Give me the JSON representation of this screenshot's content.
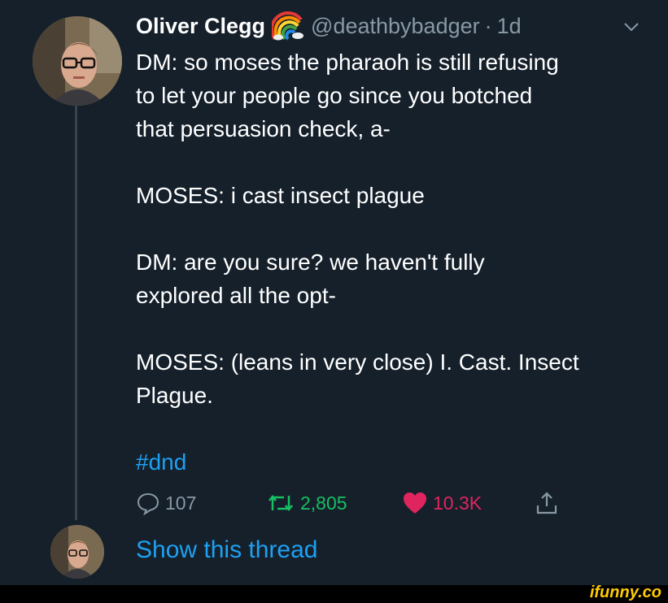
{
  "tweet": {
    "author_name": "Oliver Clegg",
    "handle": "@deathbybadger",
    "separator": "·",
    "time": "1d",
    "paragraphs": [
      "DM: so moses the pharaoh is still refusing\nto let your people go since you botched\nthat persuasion check, a-",
      "MOSES: i cast insect plague",
      "DM: are you sure? we haven't fully\nexplored all the opt-",
      "MOSES: (leans in very close) I. Cast. Insect\nPlague."
    ],
    "hashtag": "#dnd",
    "stats": {
      "replies": "107",
      "retweets": "2,805",
      "likes": "10.3K"
    },
    "show_thread": "Show this thread"
  },
  "watermark": "ifunny.co",
  "colors": {
    "background": "#15202b",
    "secondary_text": "#8899a6",
    "link": "#1da1f2",
    "retweet_active": "#17bf63",
    "like_active": "#e0245e"
  },
  "icons": [
    "rainbow-emoji-icon",
    "chevron-down-icon",
    "reply-icon",
    "retweet-icon",
    "heart-icon",
    "share-icon"
  ]
}
